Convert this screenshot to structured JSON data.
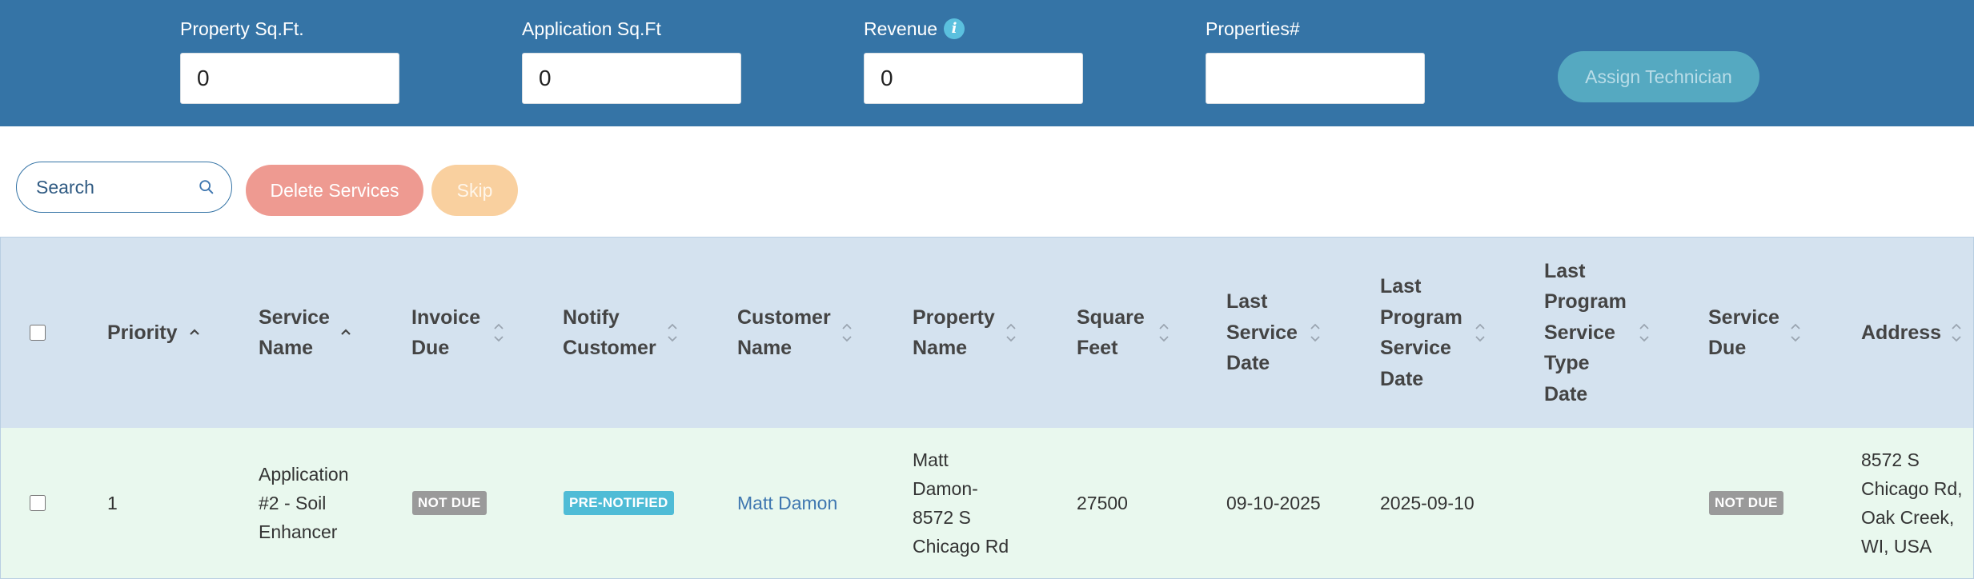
{
  "filters": {
    "property_sqft": {
      "label": "Property Sq.Ft.",
      "value": "0"
    },
    "application_sqft": {
      "label": "Application Sq.Ft",
      "value": "0"
    },
    "revenue": {
      "label": "Revenue",
      "value": "0"
    },
    "properties_count": {
      "label": "Properties#",
      "value": ""
    }
  },
  "assign_button": "Assign Technician",
  "toolbar": {
    "search_placeholder": "Search",
    "delete_label": "Delete Services",
    "skip_label": "Skip"
  },
  "table": {
    "columns": [
      "Priority",
      "Service\nName",
      "Invoice\nDue",
      "Notify\nCustomer",
      "Customer\nName",
      "Property\nName",
      "Square\nFeet",
      "Last\nService\nDate",
      "Last\nProgram\nService\nDate",
      "Last\nProgram\nService\nType\nDate",
      "Service\nDue",
      "Address"
    ],
    "sort_states": [
      "asc",
      "asc",
      "none",
      "none",
      "none",
      "none",
      "none",
      "none",
      "none",
      "none",
      "none",
      "none"
    ],
    "rows": [
      {
        "priority": "1",
        "service_name": "Application\n#2 - Soil\nEnhancer",
        "invoice_due": "NOT DUE",
        "notify_customer": "PRE-NOTIFIED",
        "customer_name": "Matt Damon",
        "property_name": "Matt\nDamon-\n8572 S\nChicago Rd",
        "square_feet": "27500",
        "last_service_date": "09-10-2025",
        "last_program_service_date": "2025-09-10",
        "last_program_service_type_date": "",
        "service_due": "NOT DUE",
        "address": "8572 S\nChicago Rd,\nOak Creek,\nWI, USA"
      }
    ]
  },
  "colors": {
    "header_bar": "#3574a6",
    "table_header": "#d4e2ef",
    "row_bg": "#e9f8ee",
    "assign_button": "#55a9c1",
    "delete_button": "#ee9a91",
    "skip_button": "#f9d09f",
    "badge_gray": "#9a9a9a",
    "badge_teal": "#4fbcd6",
    "link": "#3f77b0"
  }
}
